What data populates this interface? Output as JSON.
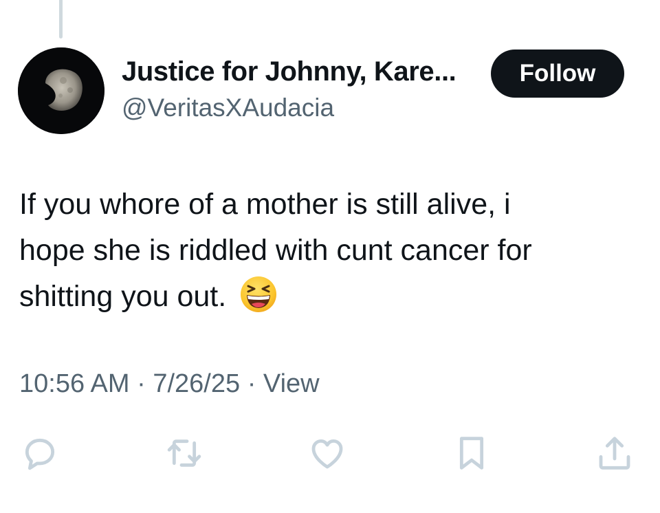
{
  "author": {
    "display_name": "Justice for Johnny, Kare...",
    "handle": "@VeritasXAudacia",
    "avatar_icon": "moon-avatar"
  },
  "follow_button": {
    "label": "Follow"
  },
  "tweet": {
    "lines": [
      "If you whore of a mother is still alive, i",
      "hope she is riddled with cunt cancer for",
      "shitting you out."
    ],
    "emoji": "grinning-squinting-face-emoji"
  },
  "meta": {
    "time": "10:56 AM",
    "separator": " · ",
    "date": "7/26/25",
    "view_label": "View"
  },
  "actions": [
    {
      "icon": "reply-icon"
    },
    {
      "icon": "retweet-icon"
    },
    {
      "icon": "like-icon"
    },
    {
      "icon": "bookmark-icon"
    },
    {
      "icon": "share-icon"
    }
  ],
  "colors": {
    "text_primary": "#0f1419",
    "text_secondary": "#536471",
    "icon": "#c7d3dc",
    "thread_line": "#cfd9de",
    "follow_bg": "#0f1419",
    "follow_text": "#ffffff"
  }
}
